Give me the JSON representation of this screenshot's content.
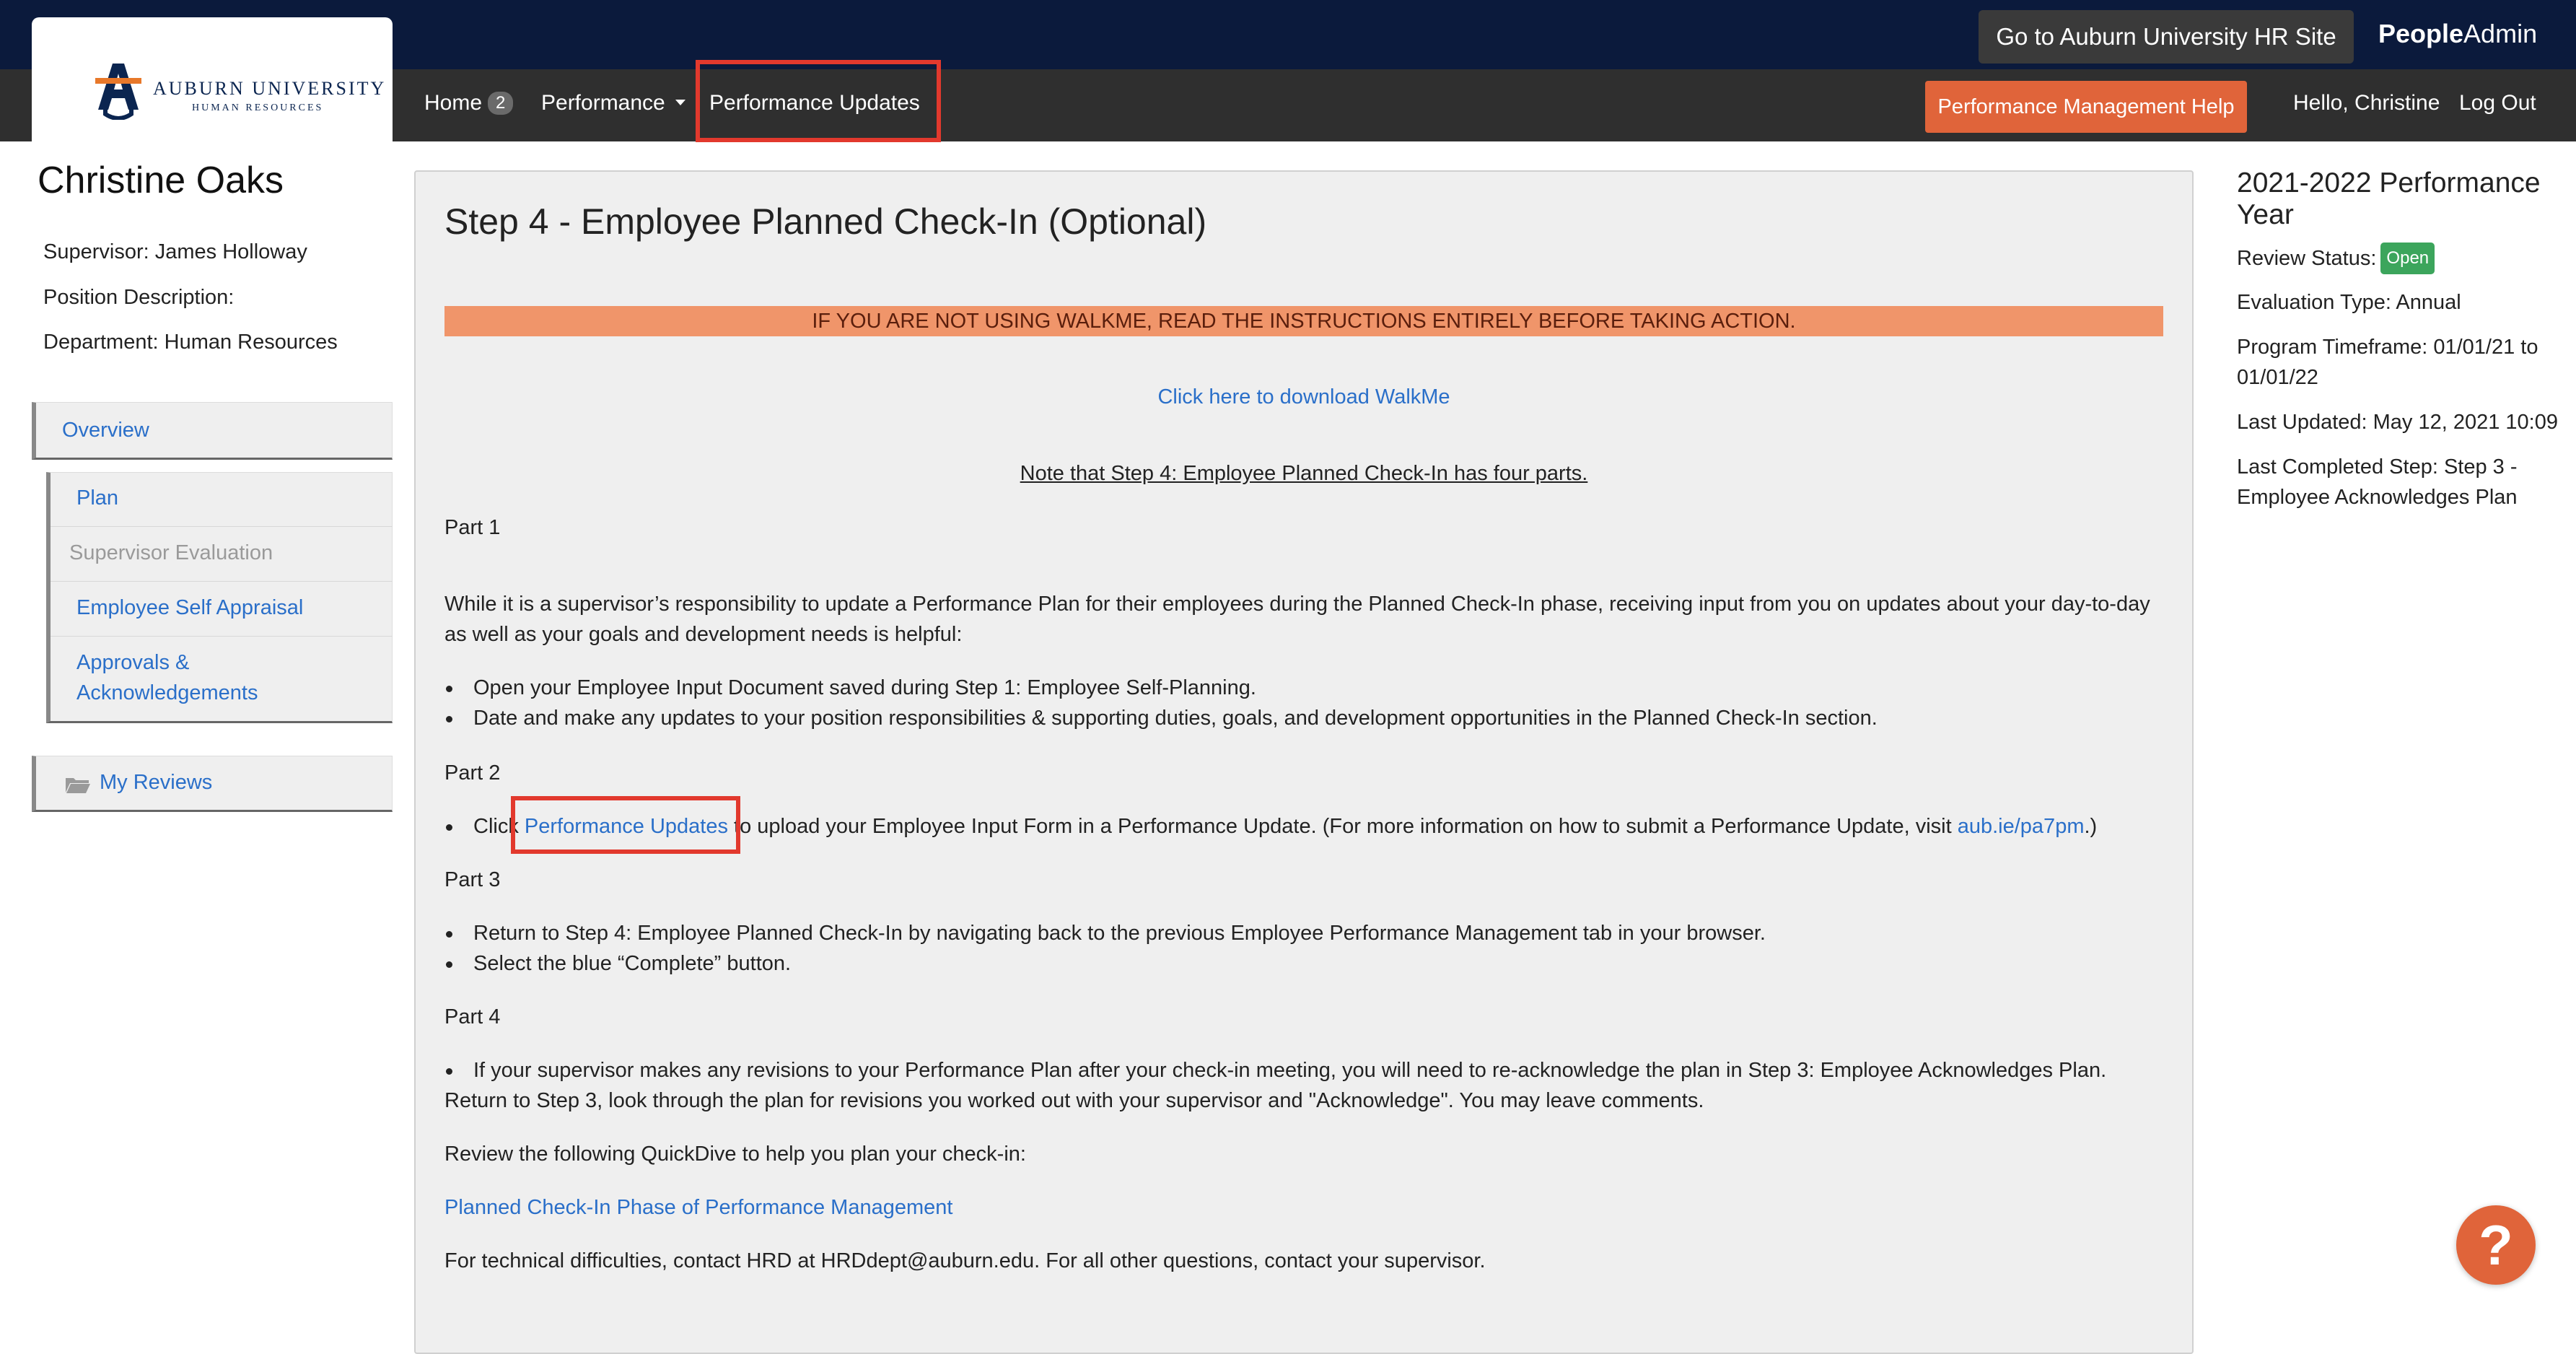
{
  "header": {
    "university_logo": {
      "line1": "AUBURN UNIVERSITY",
      "line2": "HUMAN RESOURCES"
    },
    "hr_site_button": "Go to Auburn University HR Site",
    "brand_bold": "People",
    "brand_rest": "Admin"
  },
  "nav": {
    "home": "Home",
    "home_badge": "2",
    "performance": "Performance",
    "performance_updates": "Performance Updates",
    "help_button": "Performance Management Help",
    "hello": "Hello, Christine",
    "logout": "Log Out"
  },
  "employee": {
    "name": "Christine Oaks",
    "supervisor": "Supervisor: James Holloway",
    "position_description": "Position Description:",
    "department": "Department: Human Resources"
  },
  "sidebar": {
    "overview": "Overview",
    "steps": [
      {
        "label": "Plan",
        "enabled": true
      },
      {
        "label": "Supervisor Evaluation",
        "enabled": false
      },
      {
        "label": "Employee Self Appraisal",
        "enabled": true
      },
      {
        "label": "Approvals & Acknowledgements",
        "enabled": true
      }
    ],
    "my_reviews": "My Reviews"
  },
  "main": {
    "title": "Step 4 - Employee Planned Check-In (Optional)",
    "warning": "IF YOU ARE NOT USING WALKME, READ THE INSTRUCTIONS ENTIRELY BEFORE TAKING ACTION.",
    "walkme_link": "Click here to download WalkMe",
    "note": "Note that Step 4: Employee Planned Check-In has four parts.",
    "part1_heading": "Part 1",
    "part1_intro": "While it is a supervisor’s responsibility to update a Performance Plan for their employees during the Planned Check-In phase, receiving input from you on updates about your day-to-day as well as your goals and development needs is helpful:",
    "part1_bullets": [
      "Open your Employee Input Document saved during Step 1: Employee Self-Planning.",
      "Date and make any updates to your position responsibilities & supporting duties, goals, and development opportunities in the Planned Check-In section."
    ],
    "part2_heading": "Part 2",
    "part2_pre": "Click ",
    "part2_link": "Performance Updates",
    "part2_mid": " to upload your Employee Input Form in a Performance Update. (For more information on how to submit a Performance Update, visit ",
    "part2_url": "aub.ie/pa7pm",
    "part2_post": ".)",
    "part3_heading": "Part 3",
    "part3_bullets": [
      "Return to Step 4: Employee Planned Check-In by navigating back to the previous Employee Performance Management tab in your browser.",
      "Select the blue “Complete” button."
    ],
    "part4_heading": "Part 4",
    "part4_bullet": "If your supervisor makes any revisions to your Performance Plan after your check-in meeting, you will need to re-acknowledge the plan in Step 3: Employee Acknowledges Plan.",
    "part4_cont": "Return to Step 3, look through the plan for revisions you worked out with your supervisor and \"Acknowledge\". You may leave comments.",
    "quickdive_text": "Review the following QuickDive to help you plan your check-in:",
    "quickdive_link": "Planned Check-In Phase of Performance Management",
    "contact_text": "For technical difficulties, contact HRD at HRDdept@auburn.edu. For all other questions, contact your supervisor."
  },
  "review_panel": {
    "year_title": "2021-2022 Performance Year",
    "status_label": "Review Status:",
    "status_value": "Open",
    "evaluation_type": "Evaluation Type: Annual",
    "program_timeframe": "Program Timeframe: 01/01/21 to 01/01/22",
    "last_updated": "Last Updated: May 12, 2021 10:09",
    "last_completed": "Last Completed Step: Step 3 - Employee Acknowledges Plan"
  },
  "help_fab": "?",
  "colors": {
    "top_bar": "#0b1a3c",
    "nav_bar": "#2f2f2f",
    "accent_orange": "#e0643a",
    "highlight_red": "#e2392d",
    "warning_bar": "#f0956a",
    "link_blue": "#2a6fc9",
    "status_green": "#3ca55c"
  }
}
